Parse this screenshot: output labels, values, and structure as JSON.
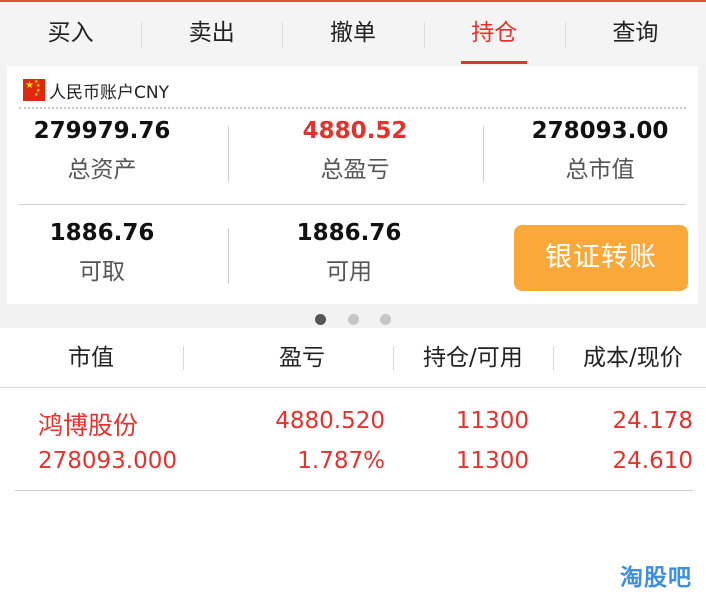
{
  "tabs": [
    {
      "label": "买入"
    },
    {
      "label": "卖出"
    },
    {
      "label": "撤单"
    },
    {
      "label": "持仓",
      "active": true
    },
    {
      "label": "查询"
    }
  ],
  "account": {
    "title": "人民币账户CNY",
    "flag_icon": "china-flag-icon",
    "total_assets": {
      "value": "279979.76",
      "label": "总资产"
    },
    "total_pnl": {
      "value": "4880.52",
      "label": "总盈亏"
    },
    "market_value": {
      "value": "278093.00",
      "label": "总市值"
    },
    "withdrawable": {
      "value": "1886.76",
      "label": "可取"
    },
    "available": {
      "value": "1886.76",
      "label": "可用"
    },
    "transfer_button": "银证转账",
    "page_index": 1,
    "page_count": 3
  },
  "table": {
    "headers": [
      "市值",
      "盈亏",
      "持仓/可用",
      "成本/现价"
    ],
    "rows": [
      {
        "name": "鸿博股份",
        "market_value": "278093.000",
        "pnl": "4880.520",
        "pnl_pct": "1.787%",
        "position": "11300",
        "available": "11300",
        "cost": "24.178",
        "price": "24.610"
      }
    ]
  },
  "watermark": "淘股吧",
  "colors": {
    "accent_red": "#e2332e",
    "button_orange": "#fba83a",
    "watermark_blue": "#3e8fe0"
  }
}
